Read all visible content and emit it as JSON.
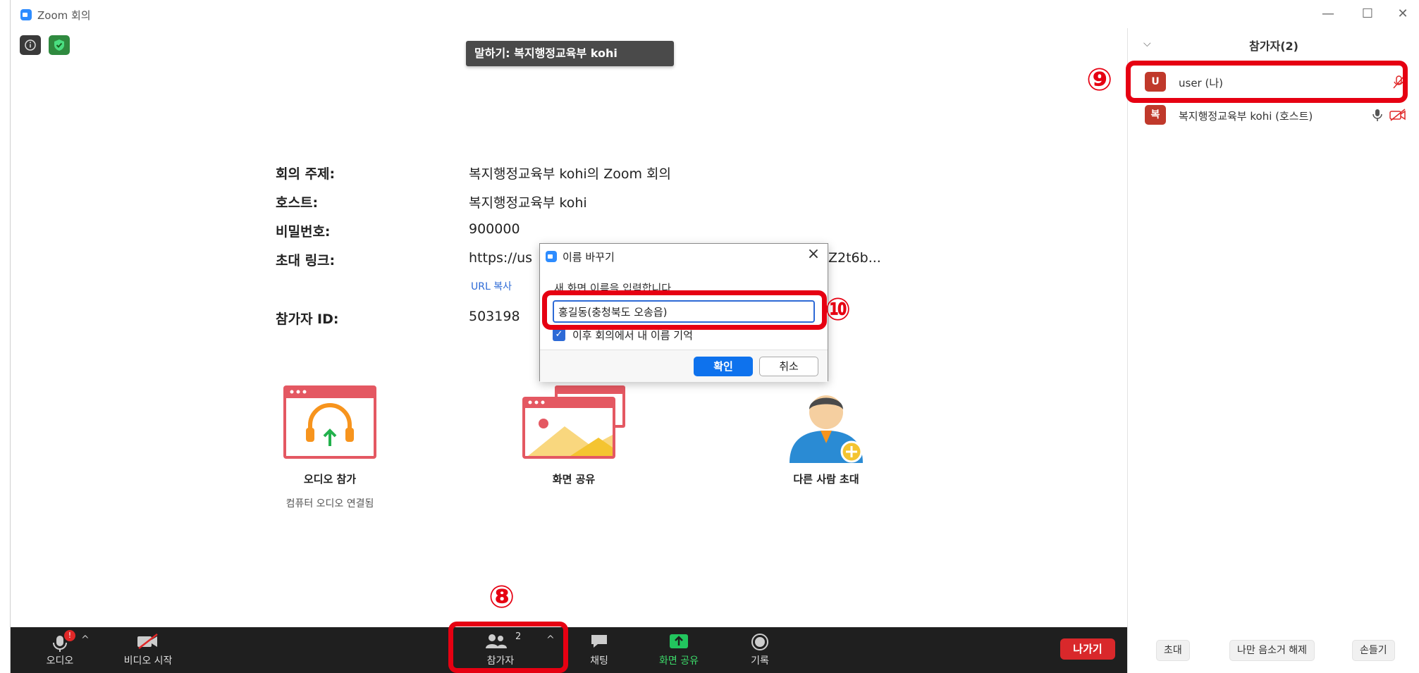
{
  "window": {
    "title": "Zoom 회의",
    "minimize": "—",
    "maximize": "☐",
    "close": "✕"
  },
  "talking": {
    "label": "말하기: 복지행정교육부 kohi"
  },
  "meeting_info": {
    "rows": [
      {
        "label": "회의 주제:",
        "value": "복지행정교육부 kohi의 Zoom 회의"
      },
      {
        "label": "호스트:",
        "value": "복지행정교육부 kohi"
      },
      {
        "label": "비밀번호:",
        "value": "900000"
      },
      {
        "label": "초대 링크:",
        "value": "https://us"
      },
      {
        "label": "참가자 ID:",
        "value": "503198"
      }
    ],
    "link_tail": "Z2t6b...",
    "copy_url": "URL 복사"
  },
  "actions": {
    "audio": {
      "label": "오디오 참가",
      "sub": "컴퓨터 오디오 연결됨"
    },
    "share": {
      "label": "화면 공유"
    },
    "invite": {
      "label": "다른 사람 초대"
    }
  },
  "toolbar": {
    "audio": "오디오",
    "audio_badge": "!",
    "video": "비디오 시작",
    "participants": "참가자",
    "participants_count": "2",
    "chat": "채팅",
    "share": "화면 공유",
    "record": "기록",
    "leave": "나가기"
  },
  "panel": {
    "title": "참가자(2)",
    "participants": [
      {
        "initial": "U",
        "name": "user (나)"
      },
      {
        "initial": "복",
        "name": "복지행정교육부 kohi (호스트)"
      }
    ],
    "footer": {
      "invite": "초대",
      "unmute": "나만 음소거 해제",
      "raise": "손들기"
    }
  },
  "dialog": {
    "title": "이름 바꾸기",
    "prompt": "새 화면 이름을 입력합니다",
    "value": "홍길동(충청북도 오송읍)",
    "remember": "이후 회의에서 내 이름 기억",
    "ok": "확인",
    "cancel": "취소"
  },
  "annotations": {
    "n8": "⑧",
    "n9": "⑨",
    "n10": "⑩"
  },
  "colors": {
    "accent": "#0e72ed",
    "leave": "#d9282b",
    "highlight": "#e60012",
    "share_green": "#22c55e"
  }
}
